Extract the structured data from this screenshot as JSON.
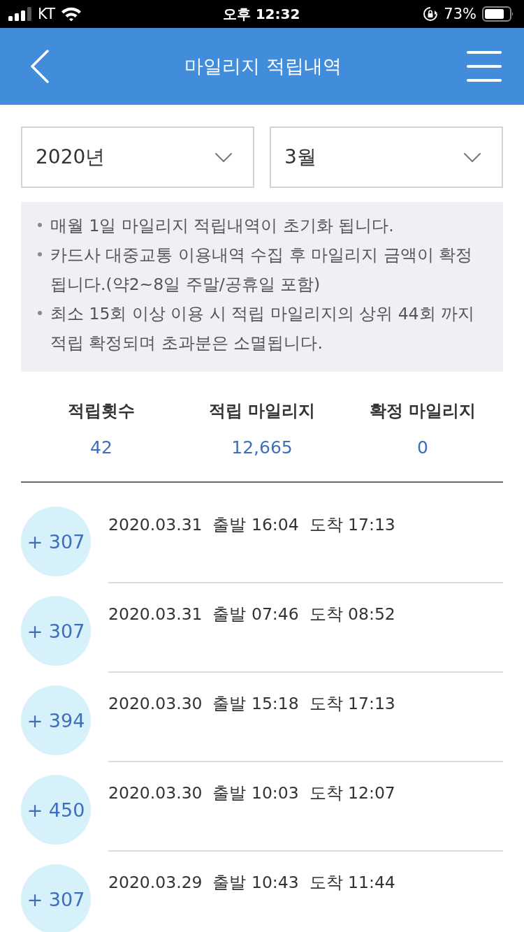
{
  "status_bar": {
    "carrier": "KT",
    "time": "오후 12:32",
    "battery": "73%"
  },
  "header": {
    "title": "마일리지 적립내역"
  },
  "filters": [
    {
      "value": "2020년"
    },
    {
      "value": "3월"
    }
  ],
  "notices": [
    "매월 1일 마일리지 적립내역이 초기화 됩니다.",
    "카드사 대중교통 이용내역 수집 후 마일리지 금액이 확정 됩니다.(약2~8일 주말/공휴일 포함)",
    "최소 15회 이상 이용 시 적립 마일리지의 상위 44회 까지 적립 확정되며 초과분은 소멸됩니다."
  ],
  "summary": [
    {
      "label": "적립횟수",
      "value": "42"
    },
    {
      "label": "적립 마일리지",
      "value": "12,665"
    },
    {
      "label": "확정 마일리지",
      "value": "0"
    }
  ],
  "records": [
    {
      "points": "+ 307",
      "detail": "2020.03.31  출발 16:04  도착 17:13"
    },
    {
      "points": "+ 307",
      "detail": "2020.03.31  출발 07:46  도착 08:52"
    },
    {
      "points": "+ 394",
      "detail": "2020.03.30  출발 15:18  도착 17:13"
    },
    {
      "points": "+ 450",
      "detail": "2020.03.30  출발 10:03  도착 12:07"
    },
    {
      "points": "+ 307",
      "detail": "2020.03.29  출발 10:43  도착 11:44"
    }
  ]
}
